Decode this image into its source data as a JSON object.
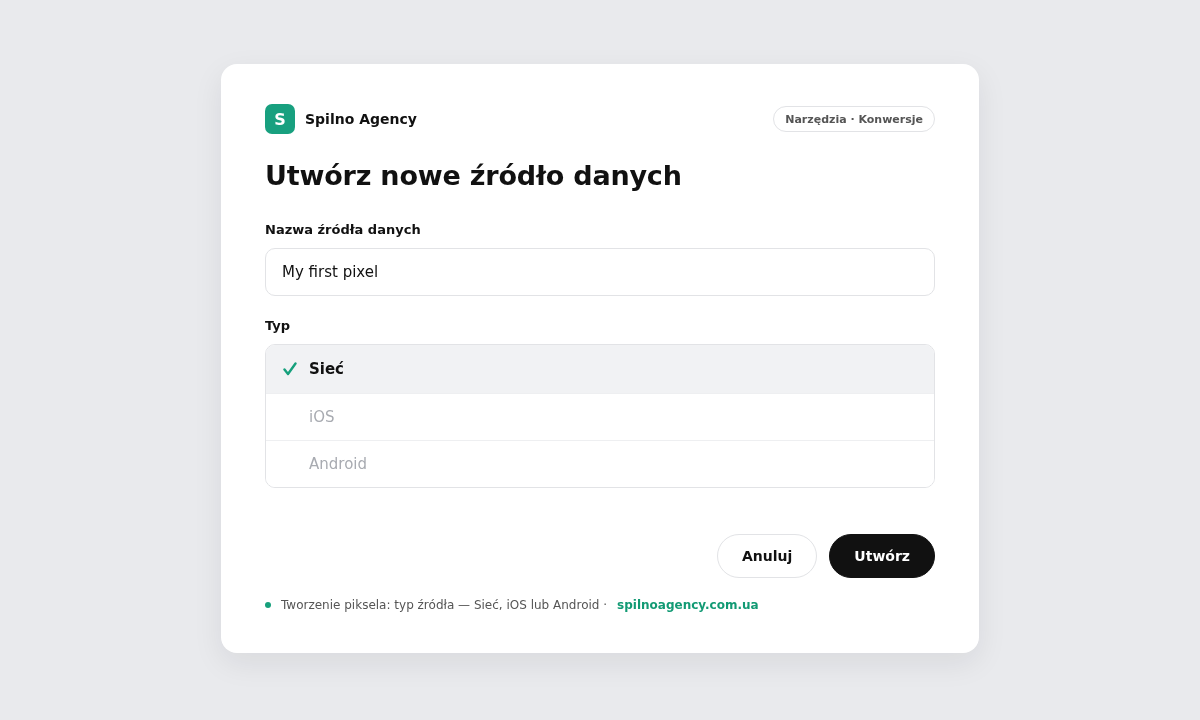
{
  "brand": {
    "logo_letter": "S",
    "name": "Spilno Agency"
  },
  "breadcrumb_badge": "Narzędzia · Konwersje",
  "title": "Utwórz nowe źródło danych",
  "name_field": {
    "label": "Nazwa źródła danych",
    "value": "My first pixel"
  },
  "type_field": {
    "label": "Typ",
    "options": [
      {
        "label": "Sieć",
        "selected": true
      },
      {
        "label": "iOS",
        "selected": false
      },
      {
        "label": "Android",
        "selected": false
      }
    ]
  },
  "buttons": [
    {
      "label": "Anuluj",
      "kind": "secondary"
    },
    {
      "label": "Utwórz",
      "kind": "primary"
    }
  ],
  "footer": {
    "note": "Tworzenie piksela: typ źródła — Sieć, iOS lub Android ·",
    "link": "spilnoagency.com.ua"
  }
}
